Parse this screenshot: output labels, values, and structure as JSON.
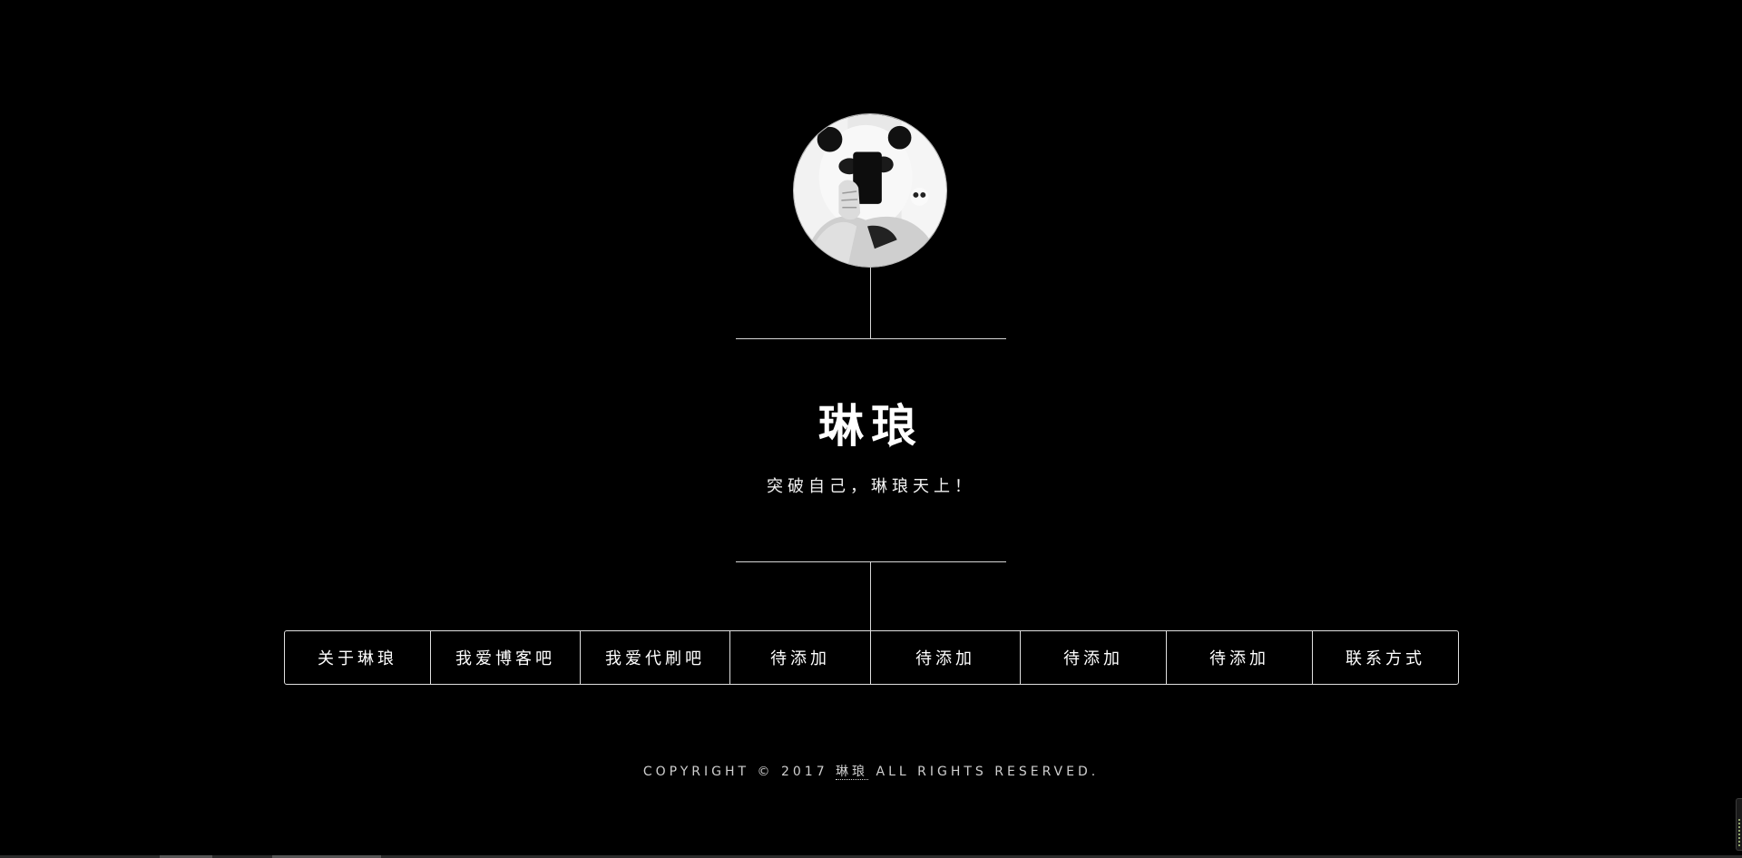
{
  "header": {
    "title": "琳琅",
    "subtitle": "突破自己，琳琅天上！",
    "avatar_icon": "avatar-panda-hood-photo"
  },
  "nav": {
    "items": [
      {
        "label": "关于琳琅"
      },
      {
        "label": "我爱博客吧"
      },
      {
        "label": "我爱代刷吧"
      },
      {
        "label": "待添加"
      },
      {
        "label": "待添加"
      },
      {
        "label": "待添加"
      },
      {
        "label": "待添加"
      },
      {
        "label": "联系方式"
      }
    ]
  },
  "footer": {
    "prefix": "COPYRIGHT © 2017",
    "owner": "琳琅",
    "suffix": "ALL RIGHTS RESERVED."
  },
  "colors": {
    "background": "#000000",
    "foreground": "#ffffff",
    "line": "#d6d6d6"
  }
}
